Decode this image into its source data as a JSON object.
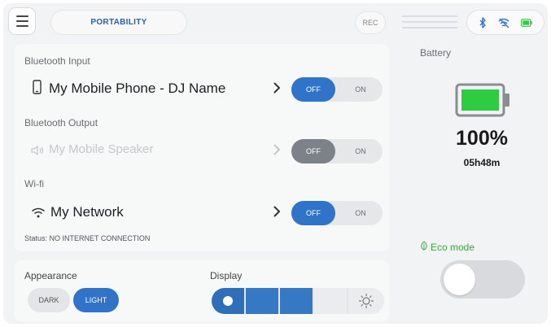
{
  "header": {
    "mode_label": "PORTABILITY",
    "rec_label": "REC"
  },
  "bluetooth_input": {
    "section_label": "Bluetooth Input",
    "device": "My Mobile Phone - DJ Name",
    "off_label": "OFF",
    "on_label": "ON",
    "state": "OFF"
  },
  "bluetooth_output": {
    "section_label": "Bluetooth Output",
    "device": "My Mobile Speaker",
    "off_label": "OFF",
    "on_label": "ON",
    "state": "OFF"
  },
  "wifi": {
    "section_label": "Wi-fi",
    "network": "My Network",
    "off_label": "OFF",
    "on_label": "ON",
    "state": "OFF",
    "status": "Status: NO INTERNET CONNECTION"
  },
  "appearance": {
    "label": "Appearance",
    "dark_label": "DARK",
    "light_label": "LIGHT",
    "selected": "LIGHT"
  },
  "display": {
    "label": "Display",
    "level": 3,
    "levels": 5
  },
  "battery": {
    "title": "Battery",
    "percent": "100%",
    "time_left": "05h48m",
    "level": 1.0
  },
  "eco": {
    "label": "Eco mode",
    "enabled": false
  },
  "colors": {
    "accent": "#2f74c8",
    "battery_fill": "#2ecc40",
    "eco_green": "#3aa63a"
  },
  "icons": [
    "menu-icon",
    "bluetooth-icon",
    "wifi-icon",
    "battery-icon",
    "phone-icon",
    "speaker-icon",
    "chevron-right-icon",
    "sun-icon",
    "leaf-icon"
  ]
}
